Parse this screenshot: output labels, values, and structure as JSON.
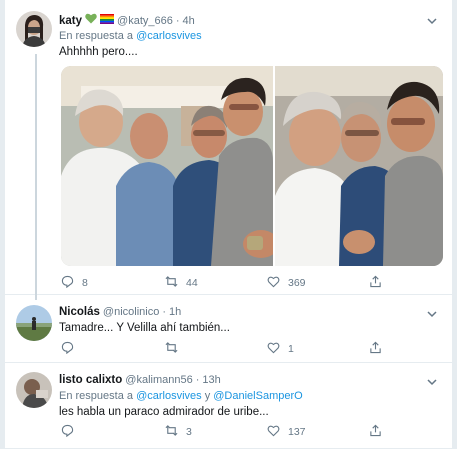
{
  "tweets": [
    {
      "name": "katy",
      "emojis": [
        "green-heart",
        "rainbow-flag"
      ],
      "handle": "@katy_666",
      "time": "4h",
      "reply_prefix": "En respuesta a",
      "reply_to": [
        "@carlosvives"
      ],
      "text": "Ahhhhh pero....",
      "replies": "8",
      "retweets": "44",
      "likes": "369"
    },
    {
      "name": "Nicolás",
      "handle": "@nicolinico",
      "time": "1h",
      "text": "Tamadre... Y Velilla ahí también...",
      "replies": "",
      "retweets": "",
      "likes": "1"
    },
    {
      "name": "listo calixto",
      "handle": "@kalimann56",
      "time": "13h",
      "reply_prefix": "En respuesta a",
      "reply_to": [
        "@carlosvives",
        "@DanielSamperO"
      ],
      "reply_joiner": "y",
      "text": "les habla un paraco admirador de uribe...",
      "replies": "",
      "retweets": "3",
      "likes": "137"
    }
  ],
  "sep": "·",
  "colors": {
    "link": "#1b95e0",
    "meta": "#657786",
    "line": "#ccd6dd"
  }
}
